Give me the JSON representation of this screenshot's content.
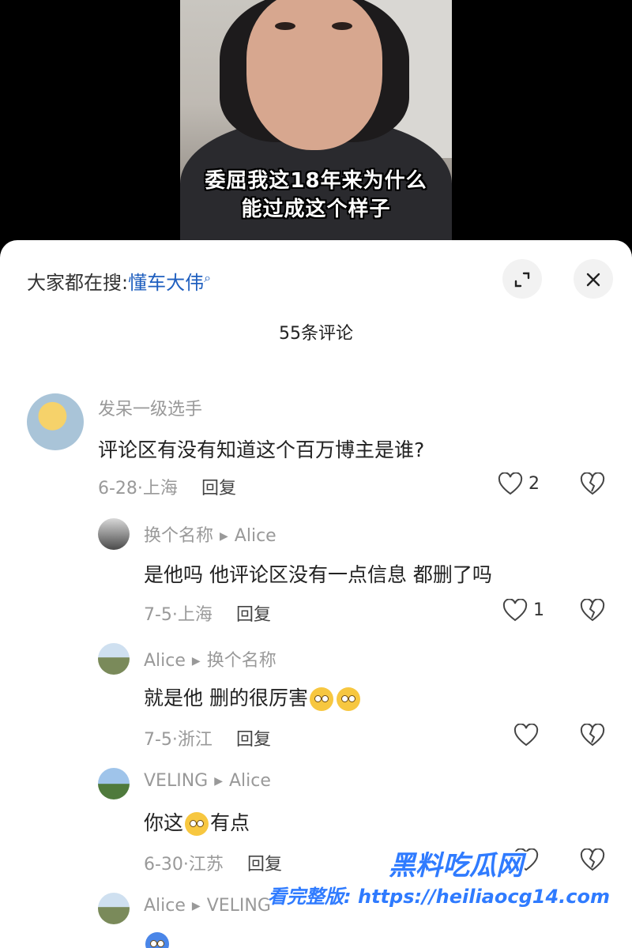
{
  "video": {
    "subtitle_line1": "委屈我这18年来为什么",
    "subtitle_line2": "能过成这个样子"
  },
  "header": {
    "search_prefix": "大家都在搜:",
    "search_keyword": "懂车大伟",
    "search_icon": "search-icon",
    "expand_icon": "expand-icon",
    "close_icon": "close-icon",
    "comment_count": "55条评论"
  },
  "comments": [
    {
      "user": "发呆一级选手",
      "text": "评论区有没有知道这个百万博主是谁?",
      "date": "6-28·上海",
      "reply_label": "回复",
      "likes": "2"
    },
    {
      "user": "换个名称",
      "reply_to": "Alice",
      "text": "是他吗 他评论区没有一点信息 都删了吗",
      "date": "7-5·上海",
      "reply_label": "回复",
      "likes": "1"
    },
    {
      "user": "Alice",
      "reply_to": "换个名称",
      "text": "就是他 删的很厉害",
      "date": "7-5·浙江",
      "reply_label": "回复",
      "likes": ""
    },
    {
      "user": "VELING",
      "reply_to": "Alice",
      "text_before": "你这",
      "text_after": "有点",
      "date": "6-30·江苏",
      "reply_label": "回复",
      "likes": ""
    },
    {
      "user": "Alice",
      "reply_to": "VELING"
    }
  ],
  "watermark": {
    "line1": "黑料吃瓜网",
    "line2": "看完整版: https://heiliaocg14.com"
  },
  "colors": {
    "link_blue": "#1f5fbf",
    "muted_gray": "#999999",
    "watermark_blue": "#2f7bff"
  }
}
